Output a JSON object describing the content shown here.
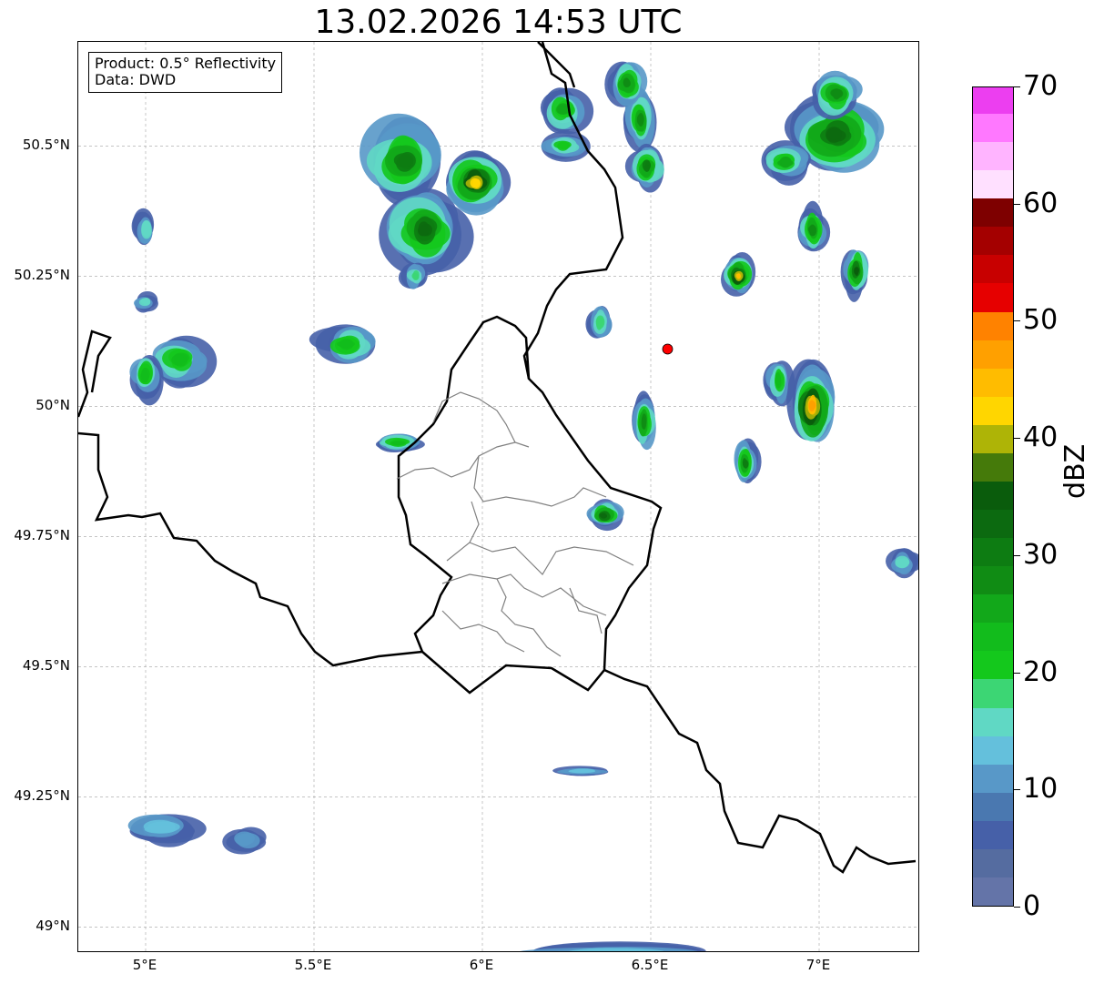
{
  "title": "13.02.2026 14:53 UTC",
  "info": {
    "product": "Product: 0.5° Reflectivity",
    "data": "Data: DWD"
  },
  "map": {
    "lon_range": [
      4.8,
      7.3
    ],
    "lat_range": [
      48.95,
      50.7
    ],
    "x_ticks": [
      {
        "lon": 5.0,
        "label": "5°E"
      },
      {
        "lon": 5.5,
        "label": "5.5°E"
      },
      {
        "lon": 6.0,
        "label": "6°E"
      },
      {
        "lon": 6.5,
        "label": "6.5°E"
      },
      {
        "lon": 7.0,
        "label": "7°E"
      }
    ],
    "y_ticks": [
      {
        "lat": 50.5,
        "label": "50.5°N"
      },
      {
        "lat": 50.25,
        "label": "50.25°N"
      },
      {
        "lat": 50.0,
        "label": "50°N"
      },
      {
        "lat": 49.75,
        "label": "49.75°N"
      },
      {
        "lat": 49.5,
        "label": "49.5°N"
      },
      {
        "lat": 49.25,
        "label": "49.25°N"
      },
      {
        "lat": 49.0,
        "label": "49°N"
      }
    ],
    "grid": true,
    "radar_site": {
      "lon": 6.55,
      "lat": 50.11,
      "color": "#ff0000"
    },
    "echo_cells": [
      {
        "lon": 5.77,
        "lat": 50.47,
        "rlon": 0.14,
        "rlat": 0.09,
        "max_dbz": 30
      },
      {
        "lon": 5.83,
        "lat": 50.34,
        "rlon": 0.13,
        "rlat": 0.08,
        "max_dbz": 32
      },
      {
        "lon": 5.98,
        "lat": 50.43,
        "rlon": 0.1,
        "rlat": 0.06,
        "max_dbz": 42
      },
      {
        "lon": 6.24,
        "lat": 50.57,
        "rlon": 0.08,
        "rlat": 0.05,
        "max_dbz": 26
      },
      {
        "lon": 6.47,
        "lat": 50.55,
        "rlon": 0.05,
        "rlat": 0.06,
        "max_dbz": 28
      },
      {
        "lon": 6.49,
        "lat": 50.46,
        "rlon": 0.06,
        "rlat": 0.05,
        "max_dbz": 30
      },
      {
        "lon": 6.43,
        "lat": 50.62,
        "rlon": 0.06,
        "rlat": 0.05,
        "max_dbz": 28
      },
      {
        "lon": 7.05,
        "lat": 50.52,
        "rlon": 0.16,
        "rlat": 0.08,
        "max_dbz": 32
      },
      {
        "lon": 7.05,
        "lat": 50.6,
        "rlon": 0.08,
        "rlat": 0.05,
        "max_dbz": 28
      },
      {
        "lon": 6.9,
        "lat": 50.47,
        "rlon": 0.09,
        "rlat": 0.04,
        "max_dbz": 26
      },
      {
        "lon": 6.98,
        "lat": 50.34,
        "rlon": 0.05,
        "rlat": 0.05,
        "max_dbz": 28
      },
      {
        "lon": 7.11,
        "lat": 50.26,
        "rlon": 0.04,
        "rlat": 0.05,
        "max_dbz": 34
      },
      {
        "lon": 6.76,
        "lat": 50.25,
        "rlon": 0.05,
        "rlat": 0.04,
        "max_dbz": 44
      },
      {
        "lon": 6.98,
        "lat": 50.0,
        "rlon": 0.07,
        "rlat": 0.08,
        "max_dbz": 46
      },
      {
        "lon": 6.88,
        "lat": 50.05,
        "rlon": 0.04,
        "rlat": 0.05,
        "max_dbz": 24
      },
      {
        "lon": 6.78,
        "lat": 49.89,
        "rlon": 0.04,
        "rlat": 0.05,
        "max_dbz": 30
      },
      {
        "lon": 6.48,
        "lat": 49.97,
        "rlon": 0.04,
        "rlat": 0.06,
        "max_dbz": 28
      },
      {
        "lon": 6.36,
        "lat": 49.79,
        "rlon": 0.06,
        "rlat": 0.03,
        "max_dbz": 32
      },
      {
        "lon": 5.75,
        "lat": 49.93,
        "rlon": 0.08,
        "rlat": 0.02,
        "max_dbz": 24
      },
      {
        "lon": 5.6,
        "lat": 50.12,
        "rlon": 0.1,
        "rlat": 0.04,
        "max_dbz": 24
      },
      {
        "lon": 5.1,
        "lat": 50.09,
        "rlon": 0.1,
        "rlat": 0.05,
        "max_dbz": 24
      },
      {
        "lon": 5.0,
        "lat": 50.06,
        "rlon": 0.05,
        "rlat": 0.05,
        "max_dbz": 22
      },
      {
        "lon": 5.0,
        "lat": 50.34,
        "rlon": 0.04,
        "rlat": 0.04,
        "max_dbz": 16
      },
      {
        "lon": 5.0,
        "lat": 50.2,
        "rlon": 0.04,
        "rlat": 0.02,
        "max_dbz": 16
      },
      {
        "lon": 5.8,
        "lat": 50.25,
        "rlon": 0.04,
        "rlat": 0.03,
        "max_dbz": 18
      },
      {
        "lon": 6.35,
        "lat": 50.16,
        "rlon": 0.04,
        "rlat": 0.04,
        "max_dbz": 18
      },
      {
        "lon": 6.24,
        "lat": 50.5,
        "rlon": 0.08,
        "rlat": 0.03,
        "max_dbz": 20
      },
      {
        "lon": 5.05,
        "lat": 49.19,
        "rlon": 0.12,
        "rlat": 0.03,
        "max_dbz": 14
      },
      {
        "lon": 5.3,
        "lat": 49.17,
        "rlon": 0.06,
        "rlat": 0.03,
        "max_dbz": 12
      },
      {
        "lon": 6.4,
        "lat": 48.95,
        "rlon": 0.38,
        "rlat": 0.02,
        "max_dbz": 14
      },
      {
        "lon": 6.3,
        "lat": 49.3,
        "rlon": 0.1,
        "rlat": 0.01,
        "max_dbz": 14
      },
      {
        "lon": 7.25,
        "lat": 49.7,
        "rlon": 0.05,
        "rlat": 0.03,
        "max_dbz": 16
      }
    ]
  },
  "colorbar": {
    "label": "dBZ",
    "min": 0,
    "max": 70,
    "ticks": [
      {
        "value": 0,
        "label": "0"
      },
      {
        "value": 10,
        "label": "10"
      },
      {
        "value": 20,
        "label": "20"
      },
      {
        "value": 30,
        "label": "30"
      },
      {
        "value": 40,
        "label": "40"
      },
      {
        "value": 50,
        "label": "50"
      },
      {
        "value": 60,
        "label": "60"
      },
      {
        "value": 70,
        "label": "70"
      }
    ],
    "colors": [
      "#6474a8",
      "#556ca0",
      "#4660a8",
      "#4a78b0",
      "#5898c8",
      "#64c0dc",
      "#60d8c4",
      "#3cd674",
      "#14c81c",
      "#12bc1c",
      "#12a81a",
      "#108c14",
      "#0d7c12",
      "#0c6a10",
      "#0a5c0c",
      "#457a0a",
      "#aeb406",
      "#ffd600",
      "#ffbc00",
      "#ffa000",
      "#ff8200",
      "#e60000",
      "#c80000",
      "#a40000",
      "#7e0000",
      "#ffe0ff",
      "#ffb4ff",
      "#ff78ff",
      "#ec3ef0"
    ]
  }
}
